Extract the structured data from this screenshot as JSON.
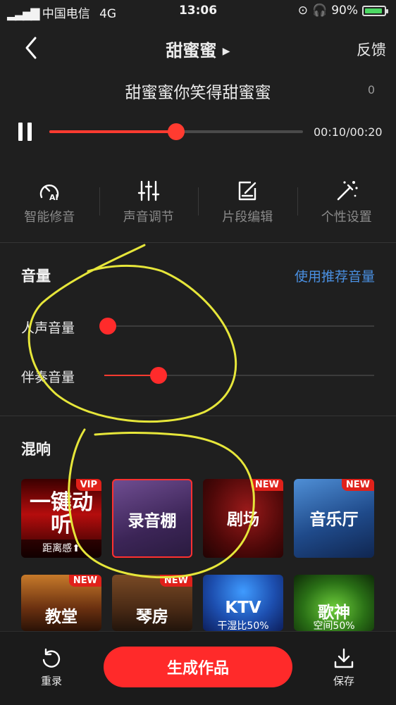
{
  "status_bar": {
    "carrier": "中国电信",
    "network": "4G",
    "time": "13:06",
    "battery": "90%"
  },
  "header": {
    "title": "甜蜜蜜",
    "feedback_label": "反馈"
  },
  "song": {
    "lyric": "甜蜜蜜你笑得甜蜜蜜",
    "count": "0"
  },
  "player": {
    "timecode": "00:10/00:20",
    "progress": 0.5
  },
  "tools": [
    {
      "label": "智能修音",
      "icon": "ai-tune-icon"
    },
    {
      "label": "声音调节",
      "icon": "equalizer-sliders-icon"
    },
    {
      "label": "片段编辑",
      "icon": "edit-note-icon"
    },
    {
      "label": "个性设置",
      "icon": "magic-wand-icon"
    }
  ],
  "volume": {
    "title": "音量",
    "recommend_link": "使用推荐音量",
    "vocal_label": "人声音量",
    "vocal_level": 0.0,
    "accomp_label": "伴奏音量",
    "accomp_level": 0.2
  },
  "reverb": {
    "title": "混响",
    "presets": [
      {
        "name": "一键动听",
        "badge": "VIP",
        "sub": "距离感⬆",
        "selected": false
      },
      {
        "name": "录音棚",
        "badge": "",
        "sub": "",
        "selected": true
      },
      {
        "name": "剧场",
        "badge": "NEW",
        "sub": "",
        "selected": false
      },
      {
        "name": "音乐厅",
        "badge": "NEW",
        "sub": "",
        "selected": false
      },
      {
        "name": "教堂",
        "badge": "NEW",
        "sub": "",
        "selected": false
      },
      {
        "name": "琴房",
        "badge": "NEW",
        "sub": "",
        "selected": false
      },
      {
        "name": "KTV",
        "badge": "",
        "sub": "干湿比50%",
        "selected": false
      },
      {
        "name": "歌神",
        "badge": "",
        "sub": "空间50%",
        "selected": false
      }
    ]
  },
  "bottom_bar": {
    "rerecord_label": "重录",
    "generate_label": "生成作品",
    "save_label": "保存"
  },
  "colors": {
    "accent": "#ff2a2a",
    "link": "#4a90e2",
    "background": "#1f1f1f"
  }
}
